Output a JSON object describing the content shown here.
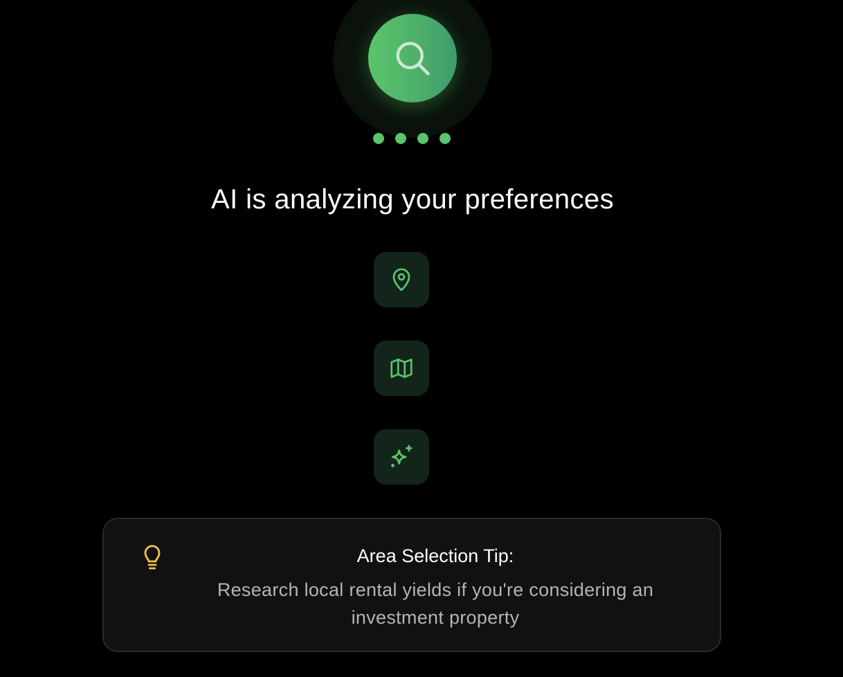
{
  "loader": {
    "headline": "AI is analyzing your preferences",
    "main_icon": "search-icon",
    "progress_dots": 4,
    "steps": [
      {
        "icon": "map-pin-icon"
      },
      {
        "icon": "map-icon"
      },
      {
        "icon": "sparkles-icon"
      }
    ]
  },
  "tip": {
    "icon": "lightbulb-icon",
    "title": "Area Selection Tip:",
    "body": "Research local rental yields if you're considering an investment property"
  },
  "colors": {
    "background": "#000000",
    "accent": "#5cc46c",
    "icon_tile": "#13251a",
    "tip_bulb": "#f2c14e",
    "card_bg": "#111111",
    "card_border": "#2b2b2b"
  }
}
